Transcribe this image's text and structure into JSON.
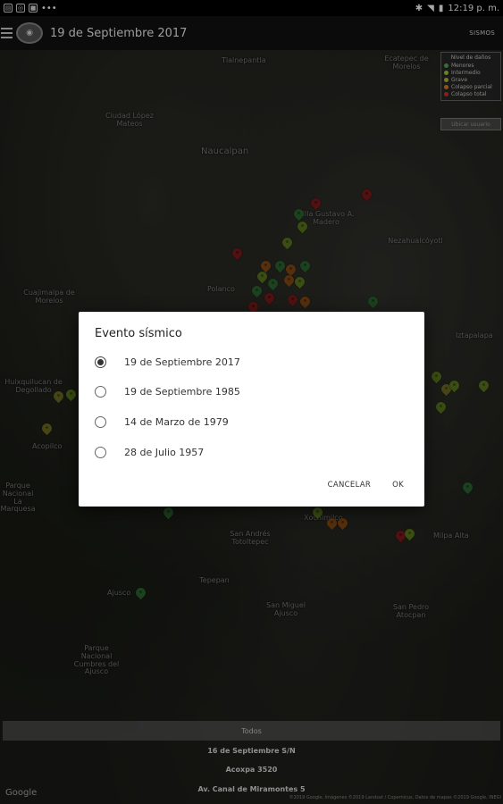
{
  "status_bar": {
    "time": "12:19 p. m.",
    "dots": "•••"
  },
  "app_bar": {
    "title": "19 de Septiembre 2017",
    "action": "SISMOS"
  },
  "legend": {
    "title": "Nivel de daños",
    "items": [
      {
        "label": "Menores",
        "color": "#4caf50"
      },
      {
        "label": "Intermedio",
        "color": "#9acd32"
      },
      {
        "label": "Grave",
        "color": "#b8b83a"
      },
      {
        "label": "Colapso parcial",
        "color": "#e67e22"
      },
      {
        "label": "Colapso total",
        "color": "#d32f2f"
      }
    ],
    "button_label": "Ubicar usuario"
  },
  "map_labels": [
    "Tlalnepantla",
    "Ciudad López Mateos",
    "Naucalpan",
    "Cuajimalpa de Morelos",
    "Huixquilucan de Degollado",
    "Acopilco",
    "Parque Nacional La Marquesa",
    "San Andrés Totoltepec",
    "San Miguel Ajusco",
    "Ajusco",
    "Parque Nacional Cumbres del Ajusco",
    "San Pedro Atocpan",
    "Ecatepec de Morelos",
    "Nezahualcóyotl",
    "Iztapalapa",
    "Milpa Alta",
    "Tepepan",
    "Xochimilco",
    "Villa Gustavo A. Madero",
    "Polanco"
  ],
  "bottom": {
    "filter_label": "Todos",
    "address_lines": [
      "16 de Septiembre S/N",
      "Acoxpa 3520",
      "Av. Canal de Miramontes 5"
    ],
    "google": "Google",
    "attribution": "©2019 Google, Imágenes ©2019 Landsat / Copernicus, Datos de mapas ©2019 Google, INEGI"
  },
  "dialog": {
    "title": "Evento sísmico",
    "options": [
      {
        "label": "19 de Septiembre 2017",
        "selected": true
      },
      {
        "label": "19 de Septiembre 1985",
        "selected": false
      },
      {
        "label": "14 de Marzo de 1979",
        "selected": false
      },
      {
        "label": "28 de Julio 1957",
        "selected": false
      }
    ],
    "cancel_label": "CANCELAR",
    "ok_label": "OK"
  }
}
